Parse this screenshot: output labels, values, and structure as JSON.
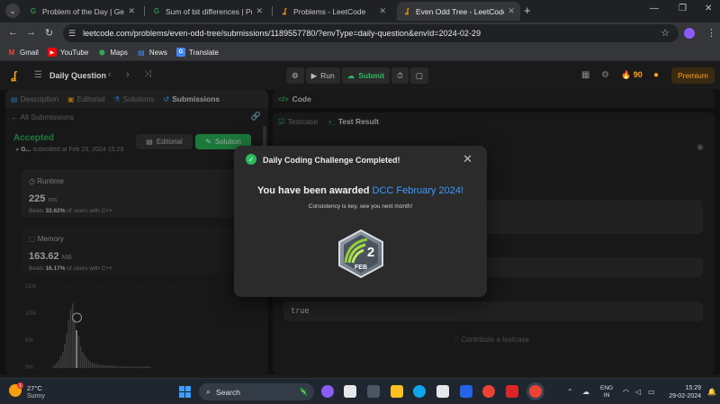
{
  "browser": {
    "tabs": [
      {
        "title": "Problem of the Day | GeeksforG",
        "favicon": "gfg-icon"
      },
      {
        "title": "Sum of bit differences | Practic",
        "favicon": "gfg-icon"
      },
      {
        "title": "Problems - LeetCode",
        "favicon": "leetcode-icon"
      },
      {
        "title": "Even Odd Tree - LeetCode",
        "favicon": "leetcode-icon"
      }
    ],
    "url": "leetcode.com/problems/even-odd-tree/submissions/1189557780/?envType=daily-question&envId=2024-02-29",
    "bookmarks": [
      {
        "label": "Gmail",
        "icon": "gmail-icon",
        "color": "#ea4335"
      },
      {
        "label": "YouTube",
        "icon": "youtube-icon",
        "color": "#ff0000"
      },
      {
        "label": "Maps",
        "icon": "maps-icon",
        "color": "#34a853"
      },
      {
        "label": "News",
        "icon": "news-icon",
        "color": "#4285f4"
      },
      {
        "label": "Translate",
        "icon": "translate-icon",
        "color": "#4285f4"
      }
    ]
  },
  "header": {
    "daily_question": "Daily Question",
    "run": "Run",
    "submit": "Submit",
    "streak": "90",
    "premium": "Premium"
  },
  "left": {
    "tabs": [
      "Description",
      "Editorial",
      "Solutions",
      "Submissions"
    ],
    "all_submissions": "All Submissions",
    "status": "Accepted",
    "user": "G...",
    "submitted_at": "submitted at Feb 29, 2024 15:29",
    "editorial_btn": "Editorial",
    "solution_btn": "Solution",
    "runtime": {
      "label": "Runtime",
      "value": "225",
      "unit": "ms",
      "beats_pre": "Beats ",
      "beats": "33.62%",
      "beats_post": " of users with C++"
    },
    "memory": {
      "label": "Memory",
      "value": "163.62",
      "unit": "MB",
      "beats_pre": "Beats ",
      "beats": "16.17%",
      "beats_post": " of users with C++"
    },
    "chart_ticks": [
      "15%",
      "10%",
      "5%",
      "0%"
    ]
  },
  "right": {
    "code_tab": "Code",
    "testcase_tab": "Testcase",
    "result_tab": "Test Result",
    "output": "true",
    "contribute": "Contribute a testcase"
  },
  "modal": {
    "title": "Daily Coding Challenge Completed!",
    "award_pre": "You have been awarded ",
    "award_highlight": "DCC February 2024!",
    "subtitle": "Consistency is key, see you next month!",
    "badge_day": "2",
    "badge_month": "FEB"
  },
  "taskbar": {
    "temp": "27°C",
    "weather": "Sunny",
    "weather_badge": "1",
    "search": "Search",
    "lang1": "ENG",
    "lang2": "IN",
    "time": "15:29",
    "date": "29-02-2024"
  },
  "chart_data": {
    "type": "bar",
    "title": "",
    "xlabel": "",
    "ylabel": "",
    "ylim": [
      0,
      15
    ],
    "values": [
      0.3,
      0.6,
      1,
      1.5,
      2.2,
      3,
      4.5,
      6.5,
      9,
      11,
      12,
      9,
      7,
      6,
      4,
      3,
      2.5,
      2,
      1.5,
      1.2,
      1,
      0.9,
      0.8,
      0.7,
      0.6,
      0.6,
      0.5,
      0.5,
      0.5,
      0.5,
      0.4,
      0.4,
      0.4,
      0.3,
      0.3,
      0.3,
      0.3,
      0.3,
      0.3,
      0.3,
      0.3,
      0.3,
      0.3,
      0.3,
      0.3,
      0.3,
      0.3,
      0.3,
      0.3,
      0.3
    ],
    "highlight_index": 12
  }
}
